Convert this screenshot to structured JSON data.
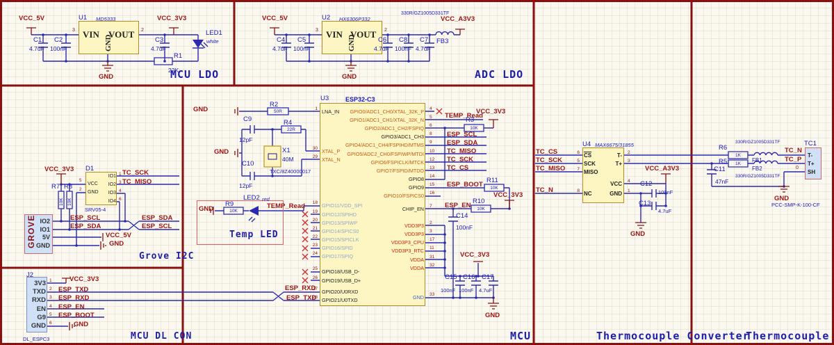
{
  "colors": {
    "wire": "#2a2ab0",
    "net_label": "#9b1313",
    "section_border": "#8a1010",
    "component_label": "#1a1ab8",
    "ic_fill": "#fdf6c3",
    "connector_fill": "#cfe0f7",
    "section_title": "#1e1ea8",
    "nc_mark": "#d03030"
  },
  "mcu_ldo": {
    "title": "MCU LDO",
    "vcc_in": "VCC_5V",
    "vcc_out": "VCC_3V3",
    "gnd": "GND",
    "u1": {
      "ref": "U1",
      "part": "MD5333",
      "pin_vin": "VIN",
      "pin_vout": "VOUT",
      "pin_gnd": "GND",
      "num_in": "3",
      "num_out": "2"
    },
    "c1_ref": "C1",
    "c1_val": "4.7uF",
    "c2_ref": "C2",
    "c2_val": "100nF",
    "c3_ref": "C3",
    "c3_val": "4.7uF",
    "r1_ref": "R1",
    "r1_val": "22K",
    "led_ref": "LED1",
    "led_val": "white"
  },
  "adc_ldo": {
    "title": "ADC LDO",
    "vcc_in": "VCC_5V",
    "vcc_out": "VCC_A3V3",
    "gnd": "GND",
    "u2": {
      "ref": "U2",
      "part": "HX6306P332",
      "pin_vin": "VIN",
      "pin_vout": "VOUT",
      "pin_gnd": "GND",
      "num_in": "3",
      "num_out": "2"
    },
    "c4_ref": "C4",
    "c4_val": "4.7uF",
    "c5_ref": "C5",
    "c5_val": "100nF",
    "c6_ref": "C6",
    "c6_val": "4.7uF",
    "c8_ref": "C8",
    "c8_val": "100nF",
    "c7_ref": "C7",
    "c7_val": "4.7uF",
    "fb3_ref": "FB3",
    "fb3_val": "330R/GZ1005D331TF"
  },
  "grove": {
    "title": "Grove I2C",
    "vcc33": "VCC_3V3",
    "vcc5": "VCC_5V",
    "gnd": "GND",
    "d1": {
      "ref": "D1",
      "part": "SRV05-4",
      "left": [
        {
          "n": "VCC",
          "p": "5"
        },
        {
          "n": "GND",
          "p": "2"
        }
      ],
      "right": [
        {
          "n": "IO1",
          "p": "1"
        },
        {
          "n": "IO2",
          "p": "3"
        },
        {
          "n": "IO3",
          "p": "4"
        },
        {
          "n": "IO4",
          "p": "6"
        }
      ]
    },
    "r7_ref": "R7",
    "r7_val": "10K",
    "r8_ref": "R8",
    "r8_val": "10K",
    "tc_sck": "TC_SCK",
    "tc_miso": "TC_MISO",
    "scl_left": "ESP_SCL",
    "sda_left": "ESP_SDA",
    "sda_right": "ESP_SDA",
    "scl_right": "ESP_SCL",
    "conn": {
      "name": "GROVE",
      "pins": [
        {
          "n": "IO2"
        },
        {
          "n": "IO1"
        },
        {
          "n": "5V"
        },
        {
          "n": "GND"
        }
      ]
    }
  },
  "dl": {
    "title": "MCU DL CON",
    "j2": {
      "ref": "J2",
      "part": "DL_ESPC3",
      "pins": [
        {
          "n": "3V3",
          "p": "1"
        },
        {
          "n": "TXD",
          "p": "2"
        },
        {
          "n": "RXD",
          "p": "3"
        },
        {
          "n": "EN",
          "p": "4"
        },
        {
          "n": "G9",
          "p": "5"
        },
        {
          "n": "GND",
          "p": "6"
        }
      ]
    },
    "vcc33": "VCC_3V3",
    "txd": "ESP_TXD",
    "rxd": "ESP_RXD",
    "en": "ESP_EN",
    "boot": "ESP_BOOT",
    "gnd": "GND"
  },
  "mcu": {
    "title": "MCU",
    "gnd_r2": "GND",
    "gnd_x1": "GND",
    "r2_ref": "R2",
    "r2_val": "50R",
    "r4_ref": "R4",
    "r4_val": "22R",
    "c9_ref": "C9",
    "c9_val": "12pF",
    "c10_ref": "C10",
    "c10_val": "12pF",
    "x1": {
      "ref": "X1",
      "val": "40M",
      "part": "TXC/8Z40000017"
    },
    "temp": {
      "gnd": "GND",
      "r9_ref": "R9",
      "r9_val": "10K",
      "led_ref": "LED2",
      "led_val": "red",
      "net": "TEMP_Read",
      "title": "Temp LED"
    },
    "rxd": "ESP_RXD",
    "txd": "ESP_TXD",
    "u3": {
      "ref": "U3",
      "part": "ESP32-C3",
      "left": [
        {
          "n": "LNA_IN",
          "p": "1",
          "k": "pl"
        },
        {
          "n": "XTAL_P",
          "p": "30",
          "k": "ad"
        },
        {
          "n": "XTAL_N",
          "p": "29",
          "k": "ad"
        },
        {
          "n": "GPIO11/VDD_SPI",
          "p": "18",
          "k": "sp"
        },
        {
          "n": "GPIO12/SPIHD",
          "p": "19",
          "k": "sp",
          "nc": "1"
        },
        {
          "n": "GPIO13/SPIWP",
          "p": "20",
          "k": "sp",
          "nc": "1"
        },
        {
          "n": "GPIO14/SPICS0",
          "p": "21",
          "k": "sp",
          "nc": "1"
        },
        {
          "n": "GPIO15/SPICLK",
          "p": "22",
          "k": "sp",
          "nc": "1"
        },
        {
          "n": "GPIO16/SPID",
          "p": "23",
          "k": "sp",
          "nc": "1"
        },
        {
          "n": "GPIO17/SPIQ",
          "p": "24",
          "k": "sp",
          "nc": "1"
        },
        {
          "n": "GPIO18/USB_D-",
          "p": "25",
          "k": "pl",
          "nc": "1"
        },
        {
          "n": "GPIO19/USB_D+",
          "p": "26",
          "k": "pl",
          "nc": "1"
        },
        {
          "n": "GPIO20/U0RXD",
          "p": "27",
          "k": "pl"
        },
        {
          "n": "GPIO21/U0TXD",
          "p": "28",
          "k": "pl"
        }
      ],
      "right": [
        {
          "n": "GPIO0/ADC1_CH0/XTAL_32K_P",
          "p": "4",
          "k": "ad",
          "nc": "1"
        },
        {
          "n": "GPIO1/ADC1_CH1/XTAL_32K_N",
          "p": "5",
          "k": "ad"
        },
        {
          "n": "GPIO2/ADC1_CH2/FSPIQ",
          "p": "6",
          "k": "ad"
        },
        {
          "n": "GPIO3/ADC1_CH3",
          "p": "8",
          "k": "pl"
        },
        {
          "n": "GPIO4/ADC1_CH4/FSPIHD/MTMS",
          "p": "9",
          "k": "ad"
        },
        {
          "n": "GPIO5/ADC2_CH0/FSPIWP/MTDI",
          "p": "10",
          "k": "ad"
        },
        {
          "n": "GPIO6/FSPICLK/MTCK",
          "p": "12",
          "k": "ad"
        },
        {
          "n": "GPIO7/FSPID/MTDO",
          "p": "13",
          "k": "ad"
        },
        {
          "n": "GPIO8",
          "p": "14",
          "k": "pl"
        },
        {
          "n": "GPIO9",
          "p": "15",
          "k": "pl"
        },
        {
          "n": "GPIO10/FSPICS0",
          "p": "16",
          "k": "ad"
        },
        {
          "n": "CHIP_EN",
          "p": "7",
          "k": "pl"
        },
        {
          "n": "VDD3P3",
          "p": "2",
          "k": "pw"
        },
        {
          "n": "VDD3P3",
          "p": "3",
          "k": "pw"
        },
        {
          "n": "VDD3P3_CPU",
          "p": "17",
          "k": "pw"
        },
        {
          "n": "VDD3P3_RTC",
          "p": "11",
          "k": "pw"
        },
        {
          "n": "VDDA",
          "p": "31",
          "k": "pw"
        },
        {
          "n": "VDDA",
          "p": "32",
          "k": "pw"
        },
        {
          "n": "GND",
          "p": "33",
          "k": "gn"
        }
      ]
    },
    "right": {
      "temp": "TEMP_Read",
      "vcc1": "VCC_3V3",
      "r3_ref": "R3",
      "r3_val": "10K",
      "scl": "ESP_SCL",
      "sda": "ESP_SDA",
      "miso": "TC_MISO",
      "sck": "TC_SCK",
      "cs": "TC_CS",
      "boot": "ESP_BOOT",
      "r11_ref": "R11",
      "r11_val": "10K",
      "vcc2": "VCC_3V3",
      "en": "ESP_EN",
      "r10_ref": "R10",
      "r10_val": "10K",
      "c14_ref": "C14",
      "c14_val": "100nF",
      "vcc3": "VCC_3V3",
      "c15_ref": "C15",
      "c15_val": "100nF",
      "c16_ref": "C16",
      "c16_val": "100nF",
      "c17_ref": "C17",
      "c17_val": "4.7uF",
      "gnd": "GND"
    }
  },
  "tconv": {
    "title": "Thermocouple Converter",
    "u4": {
      "ref": "U4",
      "part": "MAX6675/31855",
      "left": [
        {
          "n": "CS",
          "p": "6",
          "ol": "1"
        },
        {
          "n": "SCK",
          "p": "5"
        },
        {
          "n": "MISO",
          "p": "7"
        },
        {
          "n": "NC",
          "p": "8",
          "k": "nc"
        }
      ],
      "right": [
        {
          "n": "T-",
          "p": "2"
        },
        {
          "n": "T+",
          "p": "3"
        },
        {
          "n": "VCC",
          "p": "4"
        },
        {
          "n": "GND",
          "p": "1"
        }
      ]
    },
    "cs": "TC_CS",
    "sck": "TC_SCK",
    "miso": "TC_MISO",
    "tcn": "TC_N",
    "vcca": "VCC_A3V3",
    "gnd": "GND",
    "c12_ref": "C12",
    "c12_val": "100nF",
    "c13_ref": "C13",
    "c13_val": "4.7uF"
  },
  "tcon": {
    "title": "Thermocouple Con",
    "r6_ref": "R6",
    "r6_val": "1K",
    "r5_ref": "R5",
    "r5_val": "1K",
    "fb1_ref": "FB1",
    "fb1_val": "330R/GZ1005D331TF",
    "fb2_ref": "FB2",
    "fb2_val": "330R/GZ1005D331TF",
    "c11_ref": "C11",
    "c11_val": "47nF",
    "tcn": "TC_N",
    "tcp": "TC_P",
    "gnd": "GND",
    "tc1": {
      "ref": "TC1",
      "part": "PCC-SMP-K-100-CF",
      "sh_num": "0",
      "pins": [
        {
          "n": "T-"
        },
        {
          "n": "T+"
        },
        {
          "n": "SH"
        }
      ]
    }
  }
}
